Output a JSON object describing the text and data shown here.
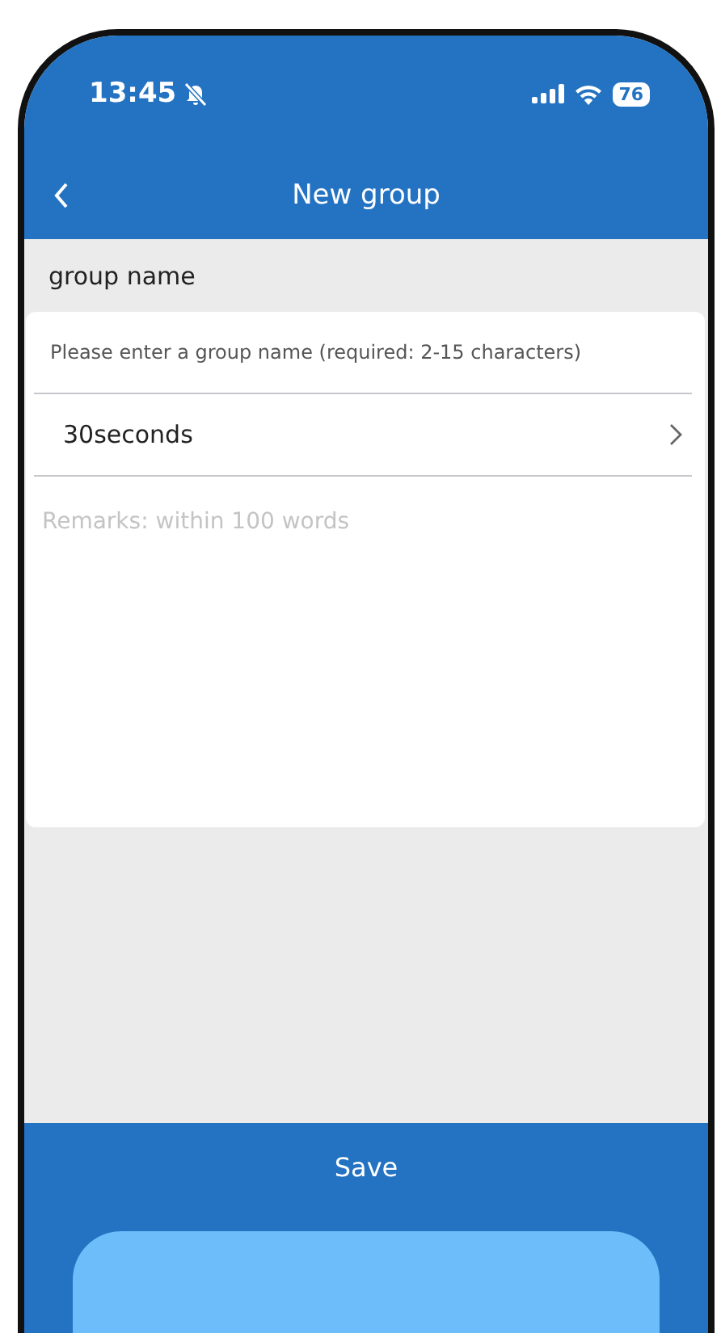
{
  "status_bar": {
    "time": "13:45",
    "battery": "76"
  },
  "nav_bar": {
    "title": "New group"
  },
  "section_label": "group name",
  "name_field": {
    "placeholder": "Please enter a group name (required: 2-15 characters)"
  },
  "interval_select": {
    "value": "30seconds"
  },
  "remarks_field": {
    "placeholder": "Remarks: within 100 words"
  },
  "save_button": {
    "label": "Save"
  }
}
